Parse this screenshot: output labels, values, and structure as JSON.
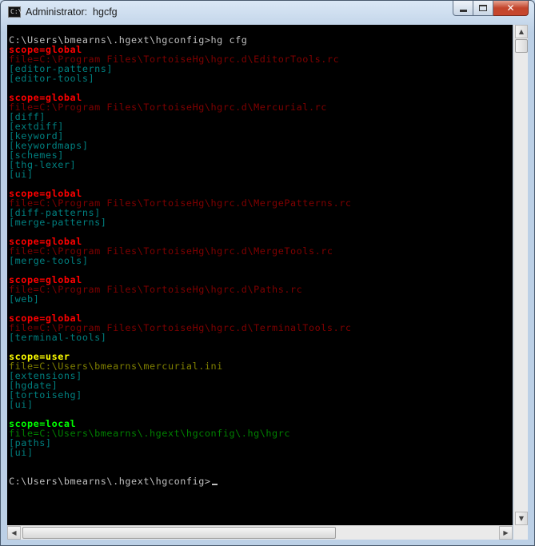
{
  "window": {
    "title": "Administrator:  hgcfg",
    "icon_label": "C:\\",
    "controls": {
      "minimize_icon": "minimize-icon",
      "maximize_icon": "maximize-icon",
      "close_glyph": "✕"
    }
  },
  "colors": {
    "console_bg": "#000000",
    "global_scope": "#ff0000",
    "global_file": "#800000",
    "section": "#008080",
    "user_scope": "#ffff00",
    "user_file": "#808000",
    "local_scope": "#00ff00",
    "local_file": "#008000",
    "default_text": "#c0c0c0"
  },
  "console": {
    "lines": [
      {
        "text": "C:\\Users\\bmearns\\.hgext\\hgconfig>hg cfg",
        "style": "w"
      },
      {
        "text": "scope=global",
        "style": "red"
      },
      {
        "text": "file=C:\\Program Files\\TortoiseHg\\hgrc.d\\EditorTools.rc",
        "style": "maroon"
      },
      {
        "text": "[editor-patterns]",
        "style": "cyan"
      },
      {
        "text": "[editor-tools]",
        "style": "cyan"
      },
      {
        "text": "",
        "style": "w"
      },
      {
        "text": "scope=global",
        "style": "red"
      },
      {
        "text": "file=C:\\Program Files\\TortoiseHg\\hgrc.d\\Mercurial.rc",
        "style": "maroon"
      },
      {
        "text": "[diff]",
        "style": "cyan"
      },
      {
        "text": "[extdiff]",
        "style": "cyan"
      },
      {
        "text": "[keyword]",
        "style": "cyan"
      },
      {
        "text": "[keywordmaps]",
        "style": "cyan"
      },
      {
        "text": "[schemes]",
        "style": "cyan"
      },
      {
        "text": "[thg-lexer]",
        "style": "cyan"
      },
      {
        "text": "[ui]",
        "style": "cyan"
      },
      {
        "text": "",
        "style": "w"
      },
      {
        "text": "scope=global",
        "style": "red"
      },
      {
        "text": "file=C:\\Program Files\\TortoiseHg\\hgrc.d\\MergePatterns.rc",
        "style": "maroon"
      },
      {
        "text": "[diff-patterns]",
        "style": "cyan"
      },
      {
        "text": "[merge-patterns]",
        "style": "cyan"
      },
      {
        "text": "",
        "style": "w"
      },
      {
        "text": "scope=global",
        "style": "red"
      },
      {
        "text": "file=C:\\Program Files\\TortoiseHg\\hgrc.d\\MergeTools.rc",
        "style": "maroon"
      },
      {
        "text": "[merge-tools]",
        "style": "cyan"
      },
      {
        "text": "",
        "style": "w"
      },
      {
        "text": "scope=global",
        "style": "red"
      },
      {
        "text": "file=C:\\Program Files\\TortoiseHg\\hgrc.d\\Paths.rc",
        "style": "maroon"
      },
      {
        "text": "[web]",
        "style": "cyan"
      },
      {
        "text": "",
        "style": "w"
      },
      {
        "text": "scope=global",
        "style": "red"
      },
      {
        "text": "file=C:\\Program Files\\TortoiseHg\\hgrc.d\\TerminalTools.rc",
        "style": "maroon"
      },
      {
        "text": "[terminal-tools]",
        "style": "cyan"
      },
      {
        "text": "",
        "style": "w"
      },
      {
        "text": "scope=user",
        "style": "yellow"
      },
      {
        "text": "file=C:\\Users\\bmearns\\mercurial.ini",
        "style": "olive"
      },
      {
        "text": "[extensions]",
        "style": "cyan"
      },
      {
        "text": "[hgdate]",
        "style": "cyan"
      },
      {
        "text": "[tortoisehg]",
        "style": "cyan"
      },
      {
        "text": "[ui]",
        "style": "cyan"
      },
      {
        "text": "",
        "style": "w"
      },
      {
        "text": "scope=local",
        "style": "lime"
      },
      {
        "text": "file=C:\\Users\\bmearns\\.hgext\\hgconfig\\.hg\\hgrc",
        "style": "green"
      },
      {
        "text": "[paths]",
        "style": "cyan"
      },
      {
        "text": "[ui]",
        "style": "cyan"
      },
      {
        "text": "",
        "style": "w"
      },
      {
        "text": "",
        "style": "w"
      },
      {
        "text": "C:\\Users\\bmearns\\.hgext\\hgconfig>",
        "style": "w",
        "cursor": true
      }
    ]
  },
  "scrollbars": {
    "up_glyph": "▲",
    "down_glyph": "▼",
    "left_glyph": "◀",
    "right_glyph": "▶"
  }
}
